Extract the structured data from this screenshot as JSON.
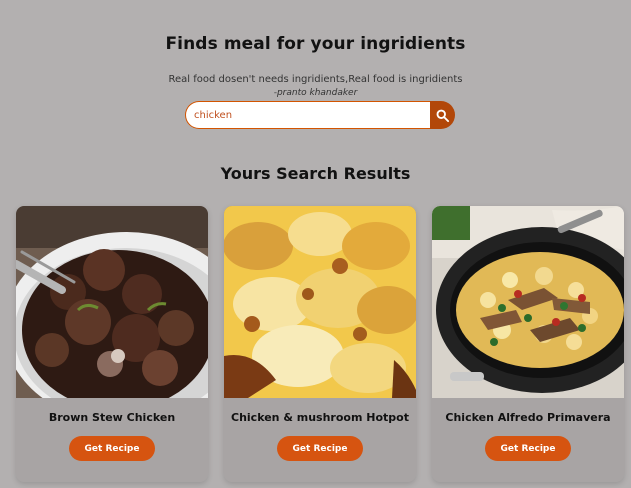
{
  "header": {
    "title": "Finds meal for your ingridients",
    "subtitle": "Real food dosen't needs ingridients,Real food is ingridients",
    "quote_author": "-pranto khandaker"
  },
  "search": {
    "value": "chicken",
    "button_icon": "search-icon"
  },
  "results": {
    "title": "Yours Search Results",
    "cards": [
      {
        "title": "Brown Stew Chicken",
        "button_label": "Get Recipe",
        "image": "brown-stew-chicken-image"
      },
      {
        "title": "Chicken & mushroom Hotpot",
        "button_label": "Get Recipe",
        "image": "chicken-mushroom-hotpot-image"
      },
      {
        "title": "Chicken Alfredo Primavera",
        "button_label": "Get Recipe",
        "image": "chicken-alfredo-primavera-image"
      }
    ]
  },
  "colors": {
    "page_background": "#b3b0b0",
    "card_background": "#a8a4a4",
    "accent": "#d65410",
    "search_button": "#b24709"
  }
}
